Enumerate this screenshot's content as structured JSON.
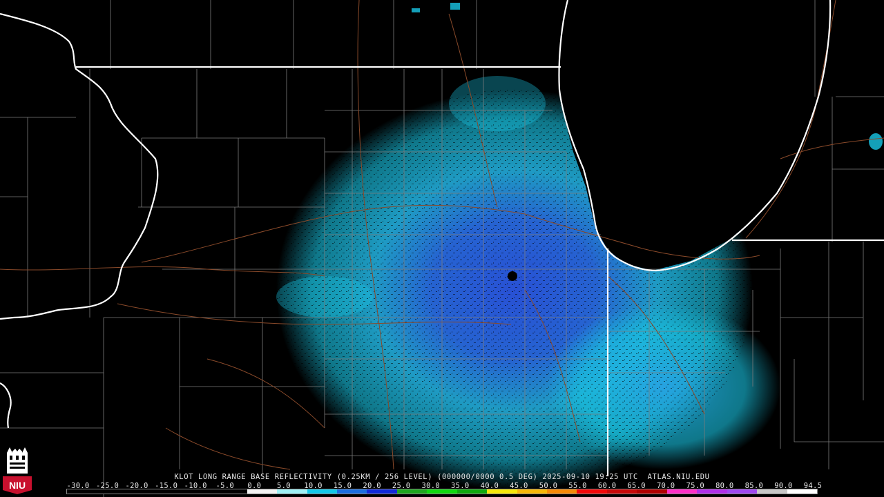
{
  "product_caption": "KLOT LONG RANGE BASE REFLECTIVITY (0.25KM / 256 LEVEL) (000000/0000 0.5 DEG) 2025-09-10 19:25 UTC  ATLAS.NIU.EDU",
  "logo_text": "NIU",
  "scale": {
    "labels": [
      "-30.0",
      "-25.0",
      "-20.0",
      "-15.0",
      "-10.0",
      "-5.0",
      "0.0",
      "5.0",
      "10.0",
      "15.0",
      "20.0",
      "25.0",
      "30.0",
      "35.0",
      "40.0",
      "45.0",
      "50.0",
      "55.0",
      "60.0",
      "65.0",
      "70.0",
      "75.0",
      "80.0",
      "85.0",
      "90.0",
      "94.5"
    ],
    "colors": [
      "#000000",
      "#000000",
      "#000000",
      "#000000",
      "#000000",
      "#000000",
      "#f2f2f2",
      "#9ff0f5",
      "#13c7e8",
      "#1a6ee0",
      "#1029d8",
      "#1ea61e",
      "#0fd80f",
      "#0ea80e",
      "#f6e80a",
      "#f7b808",
      "#f58a06",
      "#f20808",
      "#c80808",
      "#b00000",
      "#ff2ec8",
      "#b02ee8",
      "#9e48f0",
      "#c8c8c8",
      "#ffffff"
    ]
  },
  "legend_colors": {
    "background": "#000000",
    "boundaries_state": "#ffffff",
    "boundaries_county": "#7c7c7c",
    "roads": "#8a4a2a",
    "radar_site": "#000000"
  }
}
